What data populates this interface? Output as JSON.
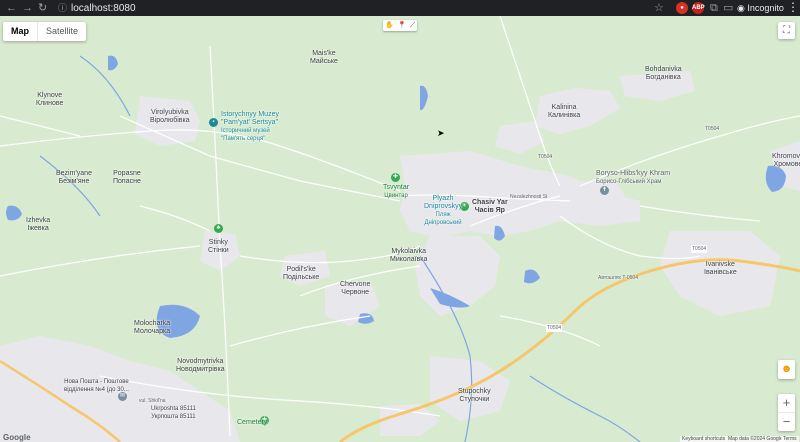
{
  "browser": {
    "url": "localhost:8080",
    "incognito_label": "Incognito",
    "extensions": [
      {
        "icon": "record-icon",
        "label": "",
        "color": "#d93025"
      },
      {
        "icon": "adblock-icon",
        "label": "ABP",
        "color": "#c5221f"
      }
    ]
  },
  "map_type": {
    "options": [
      {
        "label": "Map",
        "active": true
      },
      {
        "label": "Satellite",
        "active": false
      }
    ]
  },
  "places": [
    {
      "id": "maiske",
      "lines": [
        "Mais'ke",
        "Майське"
      ]
    },
    {
      "id": "bohdanivka",
      "lines": [
        "Bohdanivka",
        "Богданівка"
      ]
    },
    {
      "id": "klynove",
      "lines": [
        "Klynove",
        "Клинове"
      ]
    },
    {
      "id": "virolyubivka",
      "lines": [
        "Virolyubivka",
        "Віролюбівка"
      ]
    },
    {
      "id": "kalinina",
      "lines": [
        "Kalinina",
        "Калинівка"
      ]
    },
    {
      "id": "khromove",
      "lines": [
        "Khromove",
        "Хромове"
      ]
    },
    {
      "id": "bezimyane",
      "lines": [
        "Bezim'yane",
        "Безім'яне"
      ]
    },
    {
      "id": "popasne",
      "lines": [
        "Popasne",
        "Попасне"
      ]
    },
    {
      "id": "chasivyar",
      "lines": [
        "Chasiv Yar",
        "Часів Яр"
      ]
    },
    {
      "id": "izhevka",
      "lines": [
        "Izhevka",
        "Іжевка"
      ]
    },
    {
      "id": "mykolaivka",
      "lines": [
        "Mykolaivka",
        "Миколаївка"
      ]
    },
    {
      "id": "podilske",
      "lines": [
        "Podil's'ke",
        "Подільське"
      ]
    },
    {
      "id": "ivanivske",
      "lines": [
        "Ivanivske",
        "Іванівське"
      ]
    },
    {
      "id": "chervone",
      "lines": [
        "Chervone",
        "Червоне"
      ]
    },
    {
      "id": "molocharka",
      "lines": [
        "Molocharka",
        "Молочарка"
      ]
    },
    {
      "id": "novodmytrivka",
      "lines": [
        "Novodmytrivka",
        "Новодмитрівка"
      ]
    },
    {
      "id": "stupochky",
      "lines": [
        "Stupochky",
        "Ступочки"
      ]
    },
    {
      "id": "nova-poshta",
      "lines": [
        "Нова Пошта - Поштове",
        "відділення №4 (до 30..."
      ]
    },
    {
      "id": "ukrposhta",
      "lines": [
        "Ukrposhta 85111",
        "Укрпошта 85111"
      ]
    }
  ],
  "pois": [
    {
      "id": "muzey",
      "lines": [
        "Istorychnyy Muzey",
        "\"Pam'yat' Sertsya\"",
        "Історичний музей",
        "\"Пам'ять серця\""
      ]
    },
    {
      "id": "tsvyntar",
      "lines": [
        "Tsvyntar",
        "Цвинтар"
      ]
    },
    {
      "id": "plyazh",
      "lines": [
        "Plyazh",
        "Dniprovskyy",
        "Пляж",
        "Дніпровський"
      ]
    },
    {
      "id": "stinky",
      "lines": [
        "Stinky",
        "Стінки"
      ]
    },
    {
      "id": "khram",
      "lines": [
        "Boryso-Hlibs'kyy Khram",
        "Борисо-Глібський Храм"
      ]
    },
    {
      "id": "cemetery",
      "lines": [
        "Cemetery"
      ]
    }
  ],
  "roads": [
    {
      "id": "t0504-east",
      "label": "T0504"
    },
    {
      "id": "t0504-mid",
      "label": "T0504"
    },
    {
      "id": "t0504-south",
      "label": "T0504"
    },
    {
      "id": "t0504-ivan",
      "label": "T0504"
    },
    {
      "id": "avtoshlyakh",
      "label": "Автошлях T-0504"
    },
    {
      "id": "nezalezhnosti",
      "label": "Nezalezhnosti St"
    },
    {
      "id": "shkilna",
      "label": "vul. Shkil'na"
    }
  ],
  "footer": {
    "keyboard_shortcuts": "Keyboard shortcuts",
    "map_data": "Map data ©2024 Google",
    "terms": "Terms",
    "logo": "Google"
  },
  "controls": {
    "zoom_in": "+",
    "zoom_out": "−"
  },
  "colors": {
    "land": "#d8ebd0",
    "urban": "#e8e8ec",
    "water": "#7fa6e3",
    "highway": "#f6c66b",
    "poi_green": "#34a853",
    "poi_teal": "#1a8a9a",
    "poi_gray": "#78909c"
  }
}
